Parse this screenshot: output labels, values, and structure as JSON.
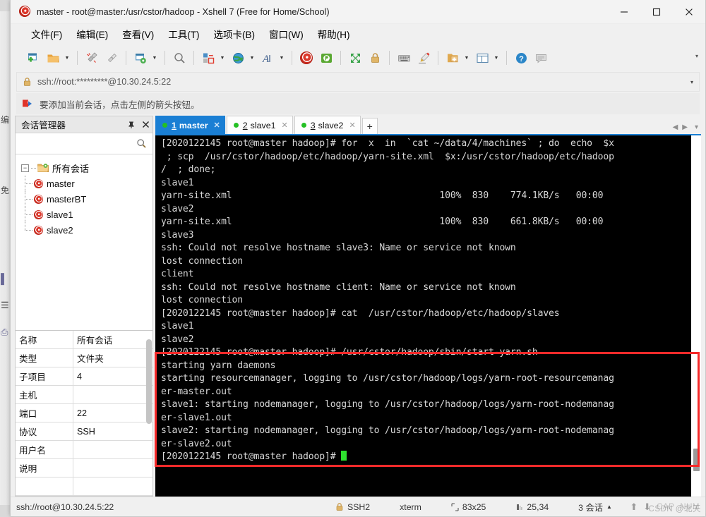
{
  "window": {
    "title": "master - root@master:/usr/cstor/hadoop - Xshell 7 (Free for Home/School)",
    "app_icon": "xshell-spiral-icon",
    "minimize": "─",
    "maximize": "□",
    "close": "✕"
  },
  "menubar": {
    "items": [
      {
        "label": "文件(F)"
      },
      {
        "label": "编辑(E)"
      },
      {
        "label": "查看(V)"
      },
      {
        "label": "工具(T)"
      },
      {
        "label": "选项卡(B)"
      },
      {
        "label": "窗口(W)"
      },
      {
        "label": "帮助(H)"
      }
    ]
  },
  "toolbar": {
    "overflow_caret": "▾",
    "buttons": [
      {
        "name": "new-session-icon"
      },
      {
        "name": "open-folder-icon",
        "caret": true
      },
      {
        "name": "disconnect-icon"
      },
      {
        "name": "reconnect-icon"
      },
      {
        "name": "session-properties-icon",
        "caret": true
      },
      {
        "name": "find-icon"
      },
      {
        "name": "transfer-file-icon",
        "caret": true
      },
      {
        "name": "globe-icon",
        "caret": true
      },
      {
        "name": "font-icon",
        "caret": true
      },
      {
        "name": "xshell-icon"
      },
      {
        "name": "xftp-icon"
      },
      {
        "name": "fullscreen-icon"
      },
      {
        "name": "lock-icon"
      },
      {
        "name": "keyboard-icon"
      },
      {
        "name": "highlight-icon"
      },
      {
        "name": "add-tab-icon",
        "caret": true
      },
      {
        "name": "split-layout-icon",
        "caret": true
      },
      {
        "name": "help-icon"
      },
      {
        "name": "comment-icon"
      }
    ]
  },
  "addressbar": {
    "lock_icon": "lock-icon",
    "value": "ssh://root:*********@10.30.24.5:22",
    "caret": "▾"
  },
  "notifybar": {
    "icon": "red-arrow-icon",
    "text": "要添加当前会话，点击左侧的箭头按钮。"
  },
  "session_manager": {
    "title": "会话管理器",
    "pin_icon": "pin-icon",
    "close_icon": "close-icon",
    "search": {
      "value": "",
      "placeholder": "",
      "icon": "search-icon"
    },
    "tree": {
      "root_label": "所有会话",
      "expander": "−",
      "children": [
        {
          "label": "master"
        },
        {
          "label": "masterBT"
        },
        {
          "label": "slave1"
        },
        {
          "label": "slave2"
        }
      ]
    },
    "properties": [
      {
        "key": "名称",
        "value": "所有会话"
      },
      {
        "key": "类型",
        "value": "文件夹"
      },
      {
        "key": "子项目",
        "value": "4"
      },
      {
        "key": "主机",
        "value": ""
      },
      {
        "key": "端口",
        "value": "22"
      },
      {
        "key": "协议",
        "value": "SSH"
      },
      {
        "key": "用户名",
        "value": ""
      },
      {
        "key": "说明",
        "value": ""
      },
      {
        "key": "",
        "value": ""
      }
    ]
  },
  "tabs": {
    "items": [
      {
        "num": "1",
        "label": "master",
        "active": true,
        "close": "✕",
        "status": "connected"
      },
      {
        "num": "2",
        "label": "slave1",
        "active": false,
        "close": "✕",
        "status": "connected"
      },
      {
        "num": "3",
        "label": "slave2",
        "active": false,
        "close": "✕",
        "status": "connected"
      }
    ],
    "add_label": "+",
    "nav_prev": "◀",
    "nav_next": "▶",
    "nav_menu": "▾"
  },
  "terminal": {
    "prompt": "[2020122145 root@master hadoop]#",
    "cursor": "block",
    "lines": [
      "[2020122145 root@master hadoop]# for  x  in  `cat ~/data/4/machines` ; do  echo  $x",
      " ; scp  /usr/cstor/hadoop/etc/hadoop/yarn-site.xml  $x:/usr/cstor/hadoop/etc/hadoop",
      "/  ; done;",
      "slave1",
      "yarn-site.xml                                      100%  830    774.1KB/s   00:00",
      "slave2",
      "yarn-site.xml                                      100%  830    661.8KB/s   00:00",
      "slave3",
      "ssh: Could not resolve hostname slave3: Name or service not known",
      "lost connection",
      "client",
      "ssh: Could not resolve hostname client: Name or service not known",
      "lost connection",
      "[2020122145 root@master hadoop]# cat  /usr/cstor/hadoop/etc/hadoop/slaves",
      "slave1",
      "slave2",
      "[2020122145 root@master hadoop]# /usr/cstor/hadoop/sbin/start-yarn.sh",
      "starting yarn daemons",
      "starting resourcemanager, logging to /usr/cstor/hadoop/logs/yarn-root-resourcemanag",
      "er-master.out",
      "slave1: starting nodemanager, logging to /usr/cstor/hadoop/logs/yarn-root-nodemanag",
      "er-slave1.out",
      "slave2: starting nodemanager, logging to /usr/cstor/hadoop/logs/yarn-root-nodemanag",
      "er-slave2.out"
    ],
    "last_line": "[2020122145 root@master hadoop]# ",
    "highlight_color": "#f62a2a"
  },
  "statusbar": {
    "connection": "ssh://root@10.30.24.5:22",
    "security": {
      "icon": "lock-icon",
      "label": "SSH2"
    },
    "terminal_type": "xterm",
    "size": {
      "icon": "size-icon",
      "label": "83x25"
    },
    "cursor_pos": {
      "icon": "cursor-icon",
      "label": "25,34"
    },
    "sessions": {
      "label": "3 会话",
      "caret": "▲"
    },
    "transfer_up": "⬆",
    "transfer_down": "⬇",
    "caps": "CAP",
    "num": "NUM",
    "watermark": "CSDN @北天"
  }
}
